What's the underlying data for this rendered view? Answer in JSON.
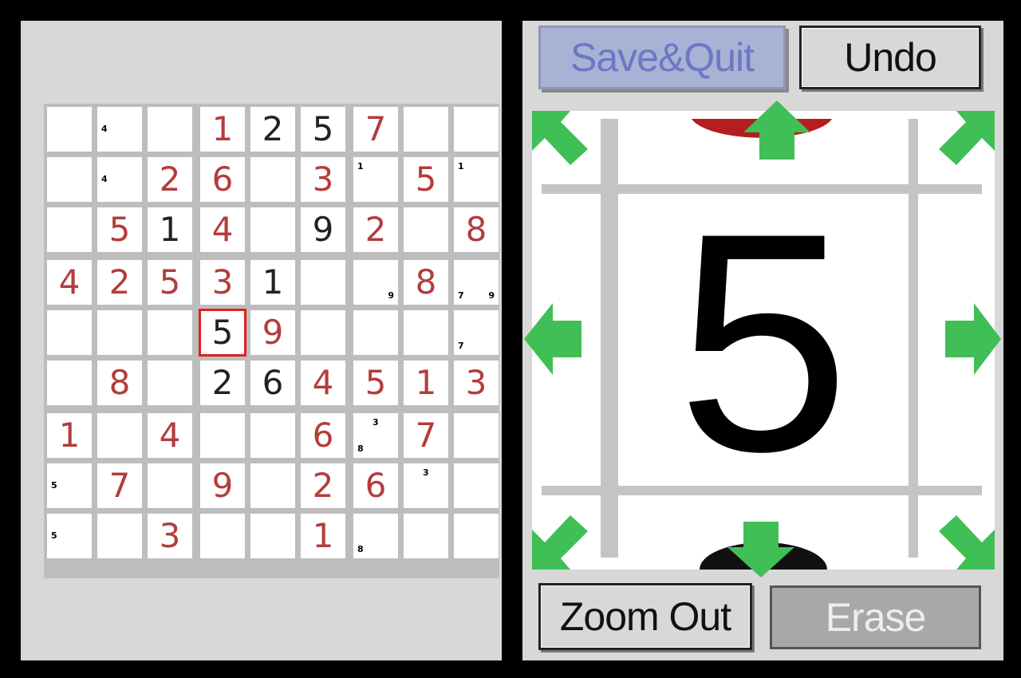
{
  "board": {
    "cells": [
      [
        {
          "v": ""
        },
        {
          "pm": [
            {
              "d": "4",
              "p": "ml"
            }
          ]
        },
        {
          "v": ""
        },
        {
          "v": "1",
          "t": "user"
        },
        {
          "v": "2",
          "t": "given"
        },
        {
          "v": "5",
          "t": "given"
        },
        {
          "v": "7",
          "t": "user"
        },
        {
          "v": ""
        },
        {
          "v": ""
        }
      ],
      [
        {
          "v": ""
        },
        {
          "pm": [
            {
              "d": "4",
              "p": "ml"
            }
          ]
        },
        {
          "v": "2",
          "t": "user"
        },
        {
          "v": "6",
          "t": "user"
        },
        {
          "v": ""
        },
        {
          "v": "3",
          "t": "user"
        },
        {
          "pm": [
            {
              "d": "1",
              "p": "tl"
            }
          ]
        },
        {
          "v": "5",
          "t": "user"
        },
        {
          "pm": [
            {
              "d": "1",
              "p": "tl"
            }
          ]
        }
      ],
      [
        {
          "v": ""
        },
        {
          "v": "5",
          "t": "user"
        },
        {
          "v": "1",
          "t": "given"
        },
        {
          "v": "4",
          "t": "user"
        },
        {
          "v": ""
        },
        {
          "v": "9",
          "t": "given"
        },
        {
          "v": "2",
          "t": "user"
        },
        {
          "v": ""
        },
        {
          "v": "8",
          "t": "user"
        }
      ],
      [
        {
          "v": "4",
          "t": "user"
        },
        {
          "v": "2",
          "t": "user"
        },
        {
          "v": "5",
          "t": "user"
        },
        {
          "v": "3",
          "t": "user"
        },
        {
          "v": "1",
          "t": "given"
        },
        {
          "v": ""
        },
        {
          "pm": [
            {
              "d": "9",
              "p": "br"
            }
          ]
        },
        {
          "v": "8",
          "t": "user"
        },
        {
          "pm": [
            {
              "d": "7",
              "p": "bl"
            },
            {
              "d": "9",
              "p": "br"
            }
          ]
        }
      ],
      [
        {
          "v": ""
        },
        {
          "v": ""
        },
        {
          "v": ""
        },
        {
          "v": "5",
          "t": "given",
          "sel": true
        },
        {
          "v": "9",
          "t": "user"
        },
        {
          "v": ""
        },
        {
          "v": ""
        },
        {
          "v": ""
        },
        {
          "pm": [
            {
              "d": "7",
              "p": "bl"
            }
          ]
        }
      ],
      [
        {
          "v": ""
        },
        {
          "v": "8",
          "t": "user"
        },
        {
          "v": ""
        },
        {
          "v": "2",
          "t": "given"
        },
        {
          "v": "6",
          "t": "given"
        },
        {
          "v": "4",
          "t": "user"
        },
        {
          "v": "5",
          "t": "user"
        },
        {
          "v": "1",
          "t": "user"
        },
        {
          "v": "3",
          "t": "user"
        }
      ],
      [
        {
          "v": "1",
          "t": "user"
        },
        {
          "v": ""
        },
        {
          "v": "4",
          "t": "user"
        },
        {
          "v": ""
        },
        {
          "v": ""
        },
        {
          "v": "6",
          "t": "user"
        },
        {
          "pm": [
            {
              "d": "3",
              "p": "tc"
            },
            {
              "d": "8",
              "p": "bl"
            }
          ]
        },
        {
          "v": "7",
          "t": "user"
        },
        {
          "v": ""
        }
      ],
      [
        {
          "pm": [
            {
              "d": "5",
              "p": "ml"
            }
          ]
        },
        {
          "v": "7",
          "t": "user"
        },
        {
          "v": ""
        },
        {
          "v": "9",
          "t": "user"
        },
        {
          "v": ""
        },
        {
          "v": "2",
          "t": "user"
        },
        {
          "v": "6",
          "t": "user"
        },
        {
          "pm": [
            {
              "d": "3",
              "p": "tc"
            }
          ]
        },
        {
          "v": ""
        }
      ],
      [
        {
          "pm": [
            {
              "d": "5",
              "p": "ml"
            }
          ]
        },
        {
          "v": ""
        },
        {
          "v": "3",
          "t": "user"
        },
        {
          "v": ""
        },
        {
          "v": ""
        },
        {
          "v": "1",
          "t": "user"
        },
        {
          "pm": [
            {
              "d": "8",
              "p": "bl"
            }
          ]
        },
        {
          "v": ""
        },
        {
          "v": ""
        }
      ]
    ]
  },
  "toolbar": {
    "save_label": "Save&Quit",
    "undo_label": "Undo",
    "zoom_out_label": "Zoom Out",
    "erase_label": "Erase"
  },
  "zoom": {
    "digit": "5"
  },
  "colors": {
    "given_digit": "#222222",
    "user_digit": "#b43c3c",
    "selection": "#e0201c",
    "arrow": "#3fbf55",
    "save_button_text": "#6b78c4"
  },
  "icons": [
    "arrow-up-icon",
    "arrow-down-icon",
    "arrow-left-icon",
    "arrow-right-icon",
    "arrow-up-left-icon",
    "arrow-up-right-icon",
    "arrow-down-left-icon",
    "arrow-down-right-icon"
  ]
}
